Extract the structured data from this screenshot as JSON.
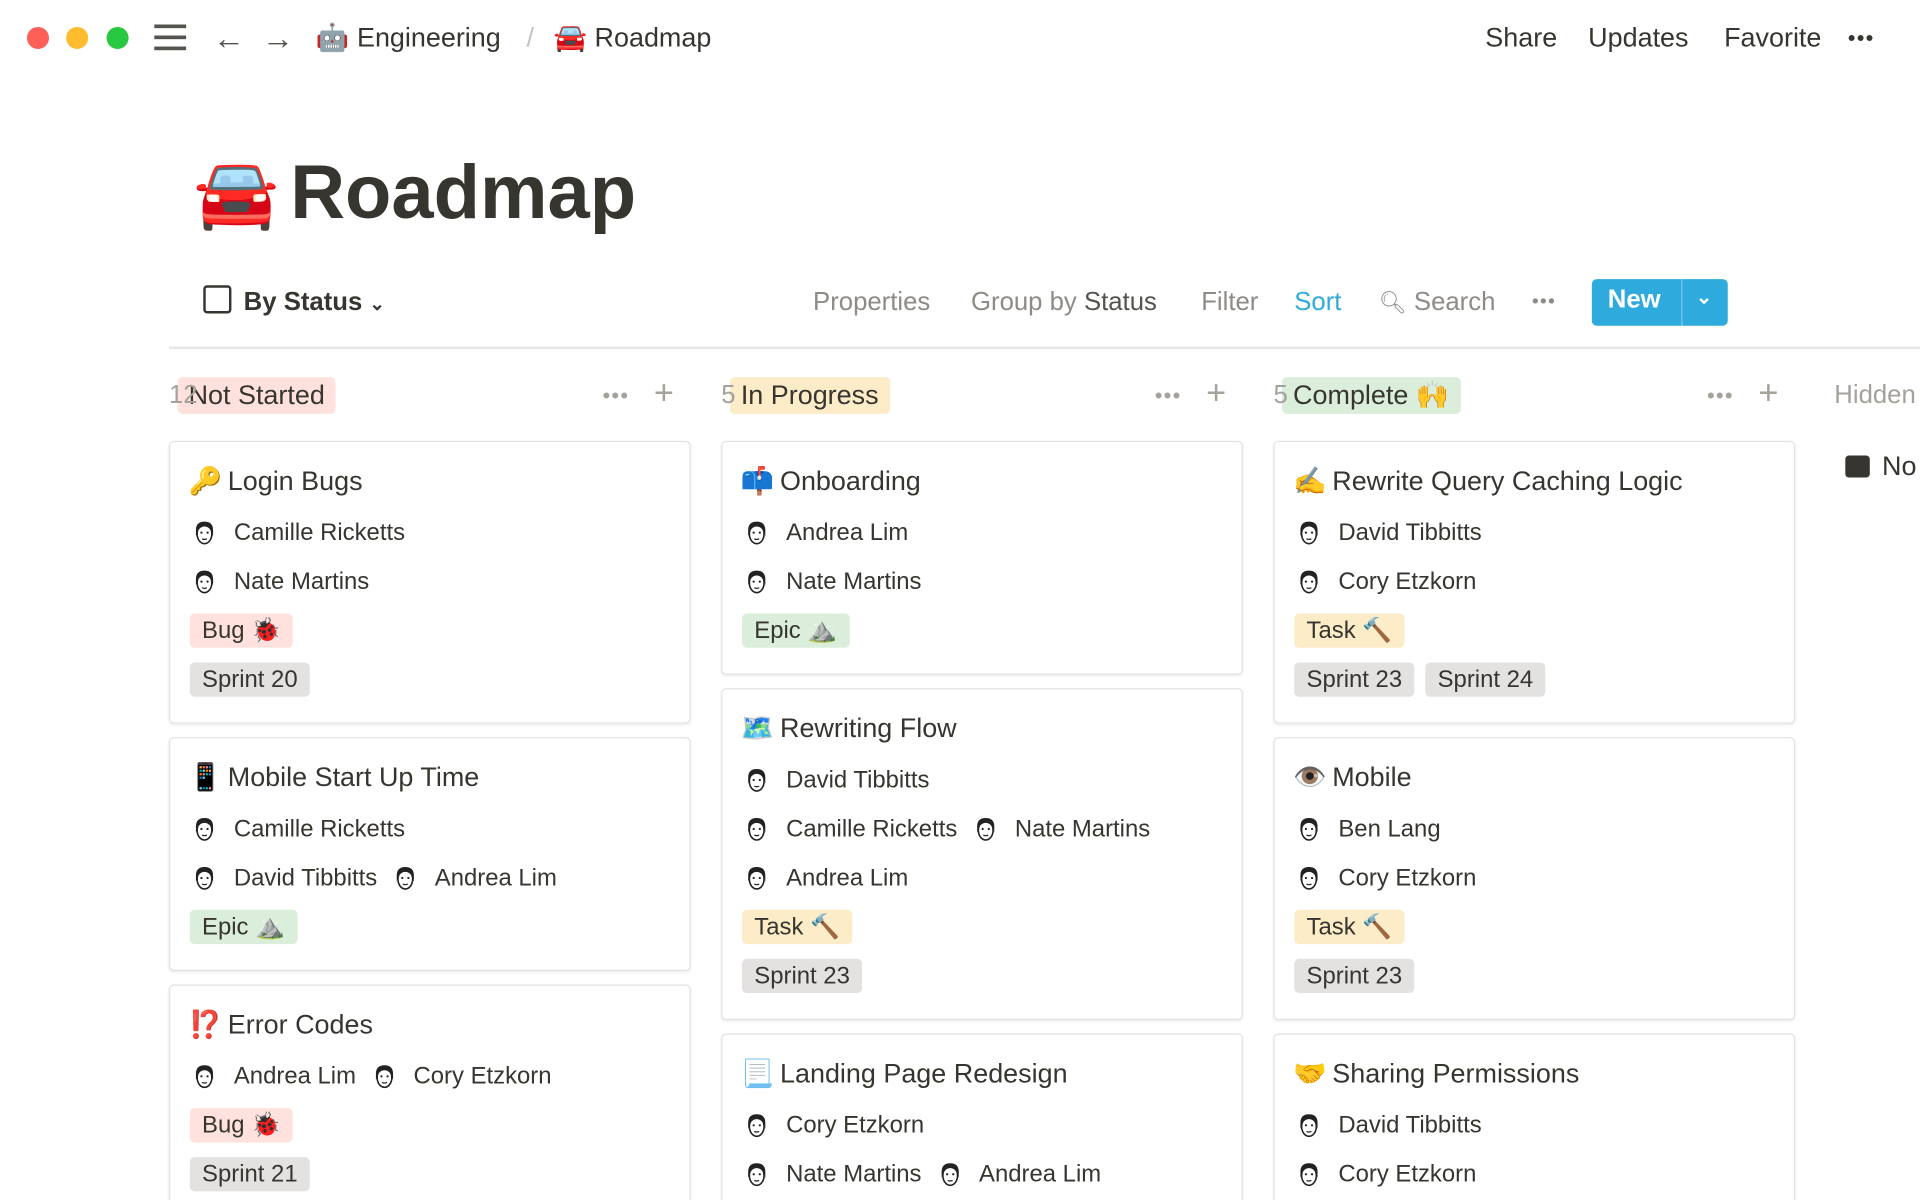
{
  "topbar": {
    "breadcrumb": [
      {
        "icon": "🤖",
        "label": "Engineering"
      },
      {
        "icon": "🚘",
        "label": "Roadmap"
      }
    ],
    "separator": "/",
    "share": "Share",
    "updates": "Updates",
    "favorite": "Favorite",
    "more": "•••"
  },
  "page": {
    "icon": "🚘",
    "title": "Roadmap"
  },
  "view": {
    "name": "By Status",
    "properties": "Properties",
    "group_by_prefix": "Group by",
    "group_by_value": "Status",
    "filter": "Filter",
    "sort": "Sort",
    "search": "Search",
    "more": "•••",
    "new": "New",
    "accent": "#2eaadc"
  },
  "colors": {
    "red": "#ffe2dd",
    "green": "#dbeddb",
    "yellow": "#fdecc8",
    "gray": "#e3e2e0"
  },
  "groups": [
    {
      "label": "Not Started",
      "count": "12",
      "color": "red",
      "cards": [
        {
          "icon": "🔑",
          "title": "Login Bugs",
          "people": [
            [
              "Camille Ricketts"
            ],
            [
              "Nate Martins"
            ]
          ],
          "tags": [
            [
              {
                "label": "Bug 🐞",
                "color": "red"
              }
            ],
            [
              {
                "label": "Sprint 20",
                "color": "gray"
              }
            ]
          ]
        },
        {
          "icon": "📱",
          "title": "Mobile Start Up Time",
          "people": [
            [
              "Camille Ricketts"
            ],
            [
              "David Tibbitts",
              "Andrea Lim"
            ]
          ],
          "tags": [
            [
              {
                "label": "Epic ⛰️",
                "color": "green"
              }
            ]
          ]
        },
        {
          "icon": "⁉️",
          "title": "Error Codes",
          "people": [
            [
              "Andrea Lim",
              "Cory Etzkorn"
            ]
          ],
          "tags": [
            [
              {
                "label": "Bug 🐞",
                "color": "red"
              }
            ],
            [
              {
                "label": "Sprint 21",
                "color": "gray"
              }
            ]
          ]
        }
      ]
    },
    {
      "label": "In Progress",
      "count": "5",
      "color": "yellow",
      "cards": [
        {
          "icon": "📫",
          "title": "Onboarding",
          "people": [
            [
              "Andrea Lim"
            ],
            [
              "Nate Martins"
            ]
          ],
          "tags": [
            [
              {
                "label": "Epic ⛰️",
                "color": "green"
              }
            ]
          ]
        },
        {
          "icon": "🗺️",
          "title": "Rewriting Flow",
          "people": [
            [
              "David Tibbitts"
            ],
            [
              "Camille Ricketts",
              "Nate Martins"
            ],
            [
              "Andrea Lim"
            ]
          ],
          "tags": [
            [
              {
                "label": "Task 🔨",
                "color": "yellow"
              }
            ],
            [
              {
                "label": "Sprint 23",
                "color": "gray"
              }
            ]
          ]
        },
        {
          "icon": "📃",
          "title": "Landing Page Redesign",
          "people": [
            [
              "Cory Etzkorn"
            ],
            [
              "Nate Martins",
              "Andrea Lim"
            ]
          ],
          "tags": []
        }
      ]
    },
    {
      "label": "Complete 🙌",
      "count": "5",
      "color": "green",
      "cards": [
        {
          "icon": "✍️",
          "title": "Rewrite Query Caching Logic",
          "people": [
            [
              "David Tibbitts"
            ],
            [
              "Cory Etzkorn"
            ]
          ],
          "tags": [
            [
              {
                "label": "Task 🔨",
                "color": "yellow"
              }
            ],
            [
              {
                "label": "Sprint 23",
                "color": "gray"
              },
              {
                "label": "Sprint 24",
                "color": "gray"
              }
            ]
          ]
        },
        {
          "icon": "👁️",
          "title": "Mobile",
          "people": [
            [
              "Ben Lang"
            ],
            [
              "Cory Etzkorn"
            ]
          ],
          "tags": [
            [
              {
                "label": "Task 🔨",
                "color": "yellow"
              }
            ],
            [
              {
                "label": "Sprint 23",
                "color": "gray"
              }
            ]
          ]
        },
        {
          "icon": "🤝",
          "title": "Sharing Permissions",
          "people": [
            [
              "David Tibbitts"
            ],
            [
              "Cory Etzkorn"
            ]
          ],
          "tags": []
        }
      ]
    }
  ],
  "hidden": {
    "label": "Hidden",
    "item": "No Status"
  }
}
